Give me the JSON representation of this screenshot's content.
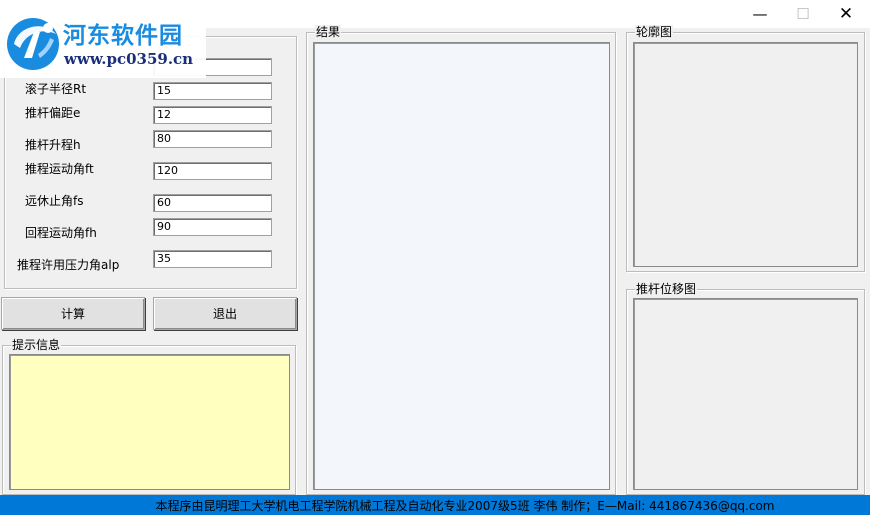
{
  "window": {
    "minimize_glyph": "—",
    "maximize_glyph": "☐",
    "close_glyph": "✕"
  },
  "watermark": {
    "title": "河东软件园",
    "url": "www.pc0359.cn",
    "brand_color": "#1a8ce0"
  },
  "params": {
    "items": [
      {
        "label": "滚子半径Rt",
        "value": "15"
      },
      {
        "label": "推杆偏距e",
        "value": "12"
      },
      {
        "label": "推杆升程h",
        "value": "80"
      },
      {
        "label": "推程运动角ft",
        "value": "120"
      },
      {
        "label": "远休止角fs",
        "value": "60"
      },
      {
        "label": "回程运动角fh",
        "value": "90"
      },
      {
        "label": "推程许用压力角alp",
        "value": "35"
      }
    ]
  },
  "buttons": {
    "compute": "计算",
    "exit": "退出"
  },
  "groups": {
    "hint": "提示信息",
    "result": "结果",
    "profile": "轮廓图",
    "displacement": "推杆位移图"
  },
  "colors": {
    "hint_bg": "#ffffc0",
    "result_bg": "#f3f6fa",
    "status_bg": "#0078d7"
  },
  "status": {
    "text": "本程序由昆明理工大学机电工程学院机械工程及自动化专业2007级5班  李伟  制作；E—Mail: 441867436@qq.com"
  }
}
